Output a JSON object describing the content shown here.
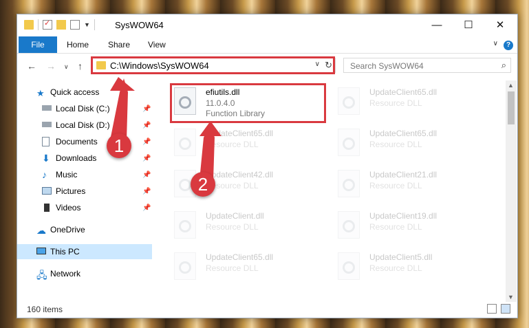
{
  "window": {
    "title": "SysWOW64"
  },
  "ribbon": {
    "file_label": "File",
    "tabs": [
      "Home",
      "Share",
      "View"
    ]
  },
  "address": {
    "path": "C:\\Windows\\SysWOW64"
  },
  "search": {
    "placeholder": "Search SysWOW64"
  },
  "nav": {
    "items": [
      {
        "label": "Quick access",
        "icon": "star-icon",
        "pinned": false
      },
      {
        "label": "Local Disk (C:)",
        "icon": "drive-icon",
        "pinned": true
      },
      {
        "label": "Local Disk (D:)",
        "icon": "drive-icon",
        "pinned": true
      },
      {
        "label": "Documents",
        "icon": "documents-icon",
        "pinned": true
      },
      {
        "label": "Downloads",
        "icon": "downloads-icon",
        "pinned": true
      },
      {
        "label": "Music",
        "icon": "music-icon",
        "pinned": true
      },
      {
        "label": "Pictures",
        "icon": "pictures-icon",
        "pinned": true
      },
      {
        "label": "Videos",
        "icon": "videos-icon",
        "pinned": true
      },
      {
        "label": "OneDrive",
        "icon": "cloud-icon",
        "pinned": false
      },
      {
        "label": "This PC",
        "icon": "pc-icon",
        "pinned": false,
        "selected": true
      },
      {
        "label": "Network",
        "icon": "network-icon",
        "pinned": false
      }
    ]
  },
  "files": [
    {
      "name": "efiutils.dll",
      "version": "11.0.4.0",
      "type": "Function Library",
      "highlighted": true
    },
    {
      "name": "UpdateClient65.dll",
      "type": "Resource DLL"
    },
    {
      "name": "UpdateClient65.dll",
      "type": "Resource DLL"
    },
    {
      "name": "UpdateClient65.dll",
      "type": "Resource DLL"
    },
    {
      "name": "UpdateClient42.dll",
      "type": "Resource DLL"
    },
    {
      "name": "UpdateClient21.dll",
      "type": "Resource DLL"
    },
    {
      "name": "UpdateClient.dll",
      "type": "Resource DLL"
    },
    {
      "name": "UpdateClient19.dll",
      "type": "Resource DLL"
    },
    {
      "name": "UpdateClient65.dll",
      "type": "Resource DLL"
    },
    {
      "name": "UpdateClient5.dll",
      "type": "Resource DLL"
    }
  ],
  "status": {
    "item_count": "160 items"
  },
  "annotations": {
    "step1": "1",
    "step2": "2"
  },
  "colors": {
    "accent": "#1979ca",
    "annotation_red": "#d9393f",
    "selected_bg": "#cce8ff"
  }
}
